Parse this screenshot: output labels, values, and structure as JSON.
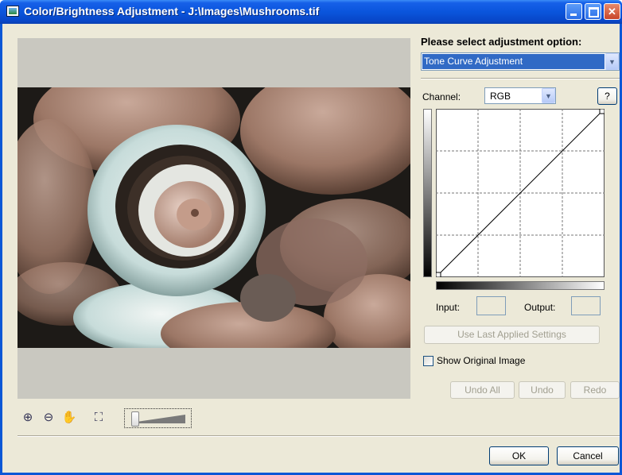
{
  "window": {
    "title": "Color/Brightness Adjustment - J:\\Images\\Mushrooms.tif",
    "icon": "image-app-icon",
    "controls": [
      "minimize",
      "maximize",
      "close"
    ]
  },
  "preview": {
    "image_subject": "mushrooms-photo",
    "tools": [
      {
        "name": "zoom-in-icon",
        "glyph": "⊕"
      },
      {
        "name": "zoom-out-icon",
        "glyph": "⊖"
      },
      {
        "name": "hand-icon",
        "glyph": "✋"
      },
      {
        "name": "fit-to-window-icon",
        "glyph": "⛶"
      }
    ],
    "zoom_slider_position": 0
  },
  "adjustment": {
    "prompt": "Please select adjustment option:",
    "selected": "Tone Curve Adjustment"
  },
  "channel": {
    "label": "Channel:",
    "selected": "RGB",
    "help_label": "?"
  },
  "curve": {
    "points": [
      [
        0,
        0
      ],
      [
        255,
        255
      ]
    ],
    "grid_divisions": 4
  },
  "io": {
    "input_label": "Input:",
    "input_value": "",
    "output_label": "Output:",
    "output_value": ""
  },
  "buttons": {
    "use_last": "Use Last Applied Settings",
    "undo_all": "Undo All",
    "undo": "Undo",
    "redo": "Redo",
    "ok": "OK",
    "cancel": "Cancel"
  },
  "show_original": {
    "label": "Show Original Image",
    "checked": false
  }
}
